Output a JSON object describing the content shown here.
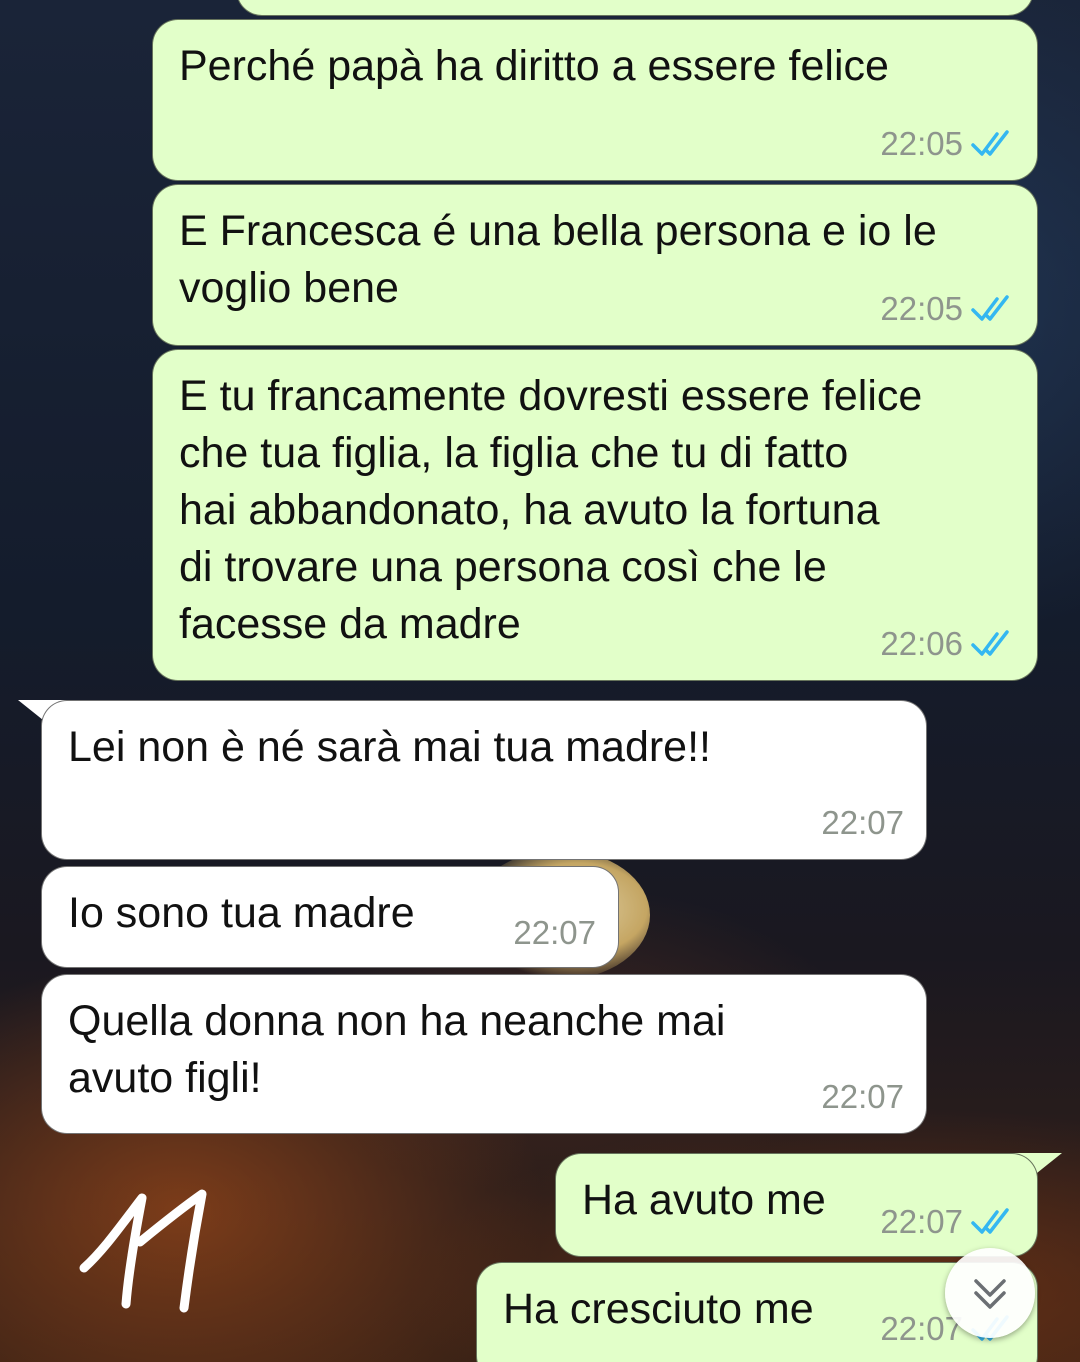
{
  "conversation": {
    "messages": [
      {
        "direction": "out",
        "text": "Perché papà ha diritto a essere felice",
        "time": "22:05",
        "status": "read"
      },
      {
        "direction": "out",
        "text": "E Francesca é una bella persona e io le\nvoglio bene",
        "time": "22:05",
        "status": "read"
      },
      {
        "direction": "out",
        "text": "E tu francamente dovresti essere felice\nche tua figlia, la figlia che tu di fatto\nhai abbandonato, ha avuto la fortuna\ndi trovare una persona così che le\nfacesse da madre",
        "time": "22:06",
        "status": "read"
      },
      {
        "direction": "in",
        "text": "Lei non è né sarà mai tua madre!!",
        "time": "22:07"
      },
      {
        "direction": "in",
        "text": "Io sono tua madre",
        "time": "22:07"
      },
      {
        "direction": "in",
        "text": "Quella donna non ha neanche mai\navuto figli!",
        "time": "22:07"
      },
      {
        "direction": "out",
        "text": "Ha avuto me",
        "time": "22:07",
        "status": "read"
      },
      {
        "direction": "out",
        "text": "Ha cresciuto me",
        "time": "22:07",
        "status": "read"
      }
    ]
  },
  "overlay": {
    "scribble_text": "11",
    "scroll_down_icon": "double-chevron-down-icon",
    "read_receipt_icon": "double-check-icon",
    "read_receipt_color": "#34b7f1"
  },
  "colors": {
    "outgoing_bubble": "#e2ffc9",
    "incoming_bubble": "#ffffff",
    "timestamp": "#8e958d"
  }
}
